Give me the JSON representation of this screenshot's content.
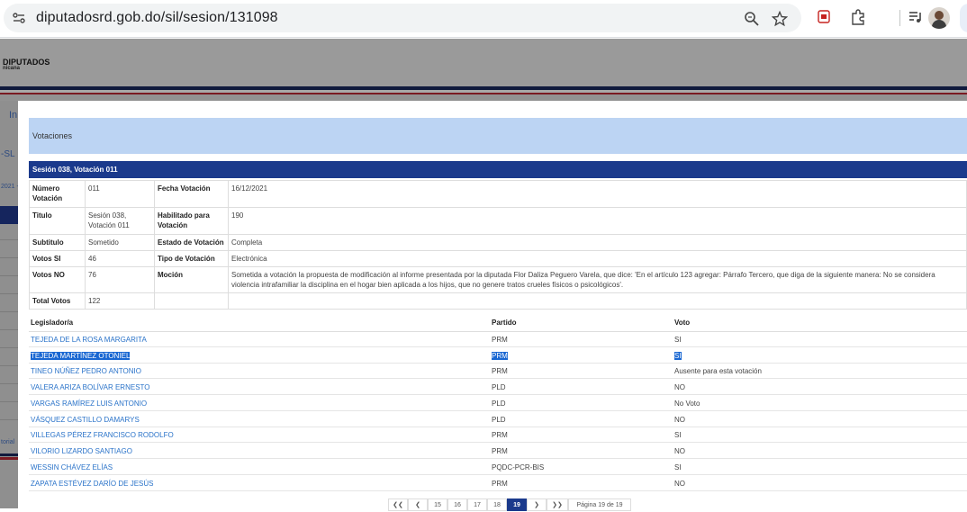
{
  "browser": {
    "url": "diputadosrd.gob.do/sil/sesion/131098"
  },
  "site": {
    "title": "DIPUTADOS",
    "subtitle": "nicana",
    "left_fragments": [
      "In",
      "-SL",
      "2021 -",
      "torial"
    ]
  },
  "modal": {
    "title": "Votaciones",
    "section": "Sesión 038, Votación 011",
    "info": {
      "numero_label": "Número Votación",
      "numero": "011",
      "fecha_label": "Fecha Votación",
      "fecha": "16/12/2021",
      "titulo_label": "Titulo",
      "titulo": "Sesión 038, Votación 011",
      "habilitado_label": "Habilitado para Votación",
      "habilitado": "190",
      "subtitulo_label": "Subtitulo",
      "subtitulo": "Sometido",
      "estado_label": "Estado de Votación",
      "estado": "Completa",
      "votos_si_label": "Votos SI",
      "votos_si": "46",
      "tipo_label": "Tipo de Votación",
      "tipo": "Electrónica",
      "votos_no_label": "Votos NO",
      "votos_no": "76",
      "mocion_label": "Moción",
      "mocion": "Sometida a votación la propuesta de modificación al informe presentada por la diputada Flor Daliza Peguero Varela, que dice: 'En el artículo 123 agregar: Párrafo Tercero, que diga de la siguiente manera: No se considera violencia intrafamiliar la disciplina en el hogar bien aplicada a los hijos, que no genere tratos crueles físicos o psicológicos'.",
      "total_label": "Total Votos",
      "total": "122"
    },
    "columns": {
      "legislador": "Legislador/a",
      "partido": "Partido",
      "voto": "Voto"
    },
    "rows": [
      {
        "name": "TEJEDA DE LA ROSA MARGARITA",
        "party": "PRM",
        "vote": "SI"
      },
      {
        "name": "TEJEDA MARTÍNEZ OTONIEL",
        "party": "PRM",
        "vote": "SI"
      },
      {
        "name": "TINEO NÚÑEZ PEDRO ANTONIO",
        "party": "PRM",
        "vote": "Ausente para esta votación"
      },
      {
        "name": "VALERA ARIZA BOLÍVAR ERNESTO",
        "party": "PLD",
        "vote": "NO"
      },
      {
        "name": "VARGAS RAMÍREZ LUIS ANTONIO",
        "party": "PLD",
        "vote": "No Voto"
      },
      {
        "name": "VÁSQUEZ CASTILLO DAMARYS",
        "party": "PLD",
        "vote": "NO"
      },
      {
        "name": "VILLEGAS PÉREZ FRANCISCO RODOLFO",
        "party": "PRM",
        "vote": "SI"
      },
      {
        "name": "VILORIO LIZARDO SANTIAGO",
        "party": "PRM",
        "vote": "NO"
      },
      {
        "name": "WESSIN CHÁVEZ ELÍAS",
        "party": "PQDC-PCR-BIS",
        "vote": "SI"
      },
      {
        "name": "ZAPATA ESTÉVEZ DARÍO DE JESÚS",
        "party": "PRM",
        "vote": "NO"
      }
    ],
    "pagination": {
      "first": "❮❮",
      "prev": "❮",
      "pages": [
        "15",
        "16",
        "17",
        "18",
        "19"
      ],
      "current": "19",
      "next": "❯",
      "last": "❯❯",
      "info": "Página 19 de 19"
    }
  },
  "colors": {
    "navy": "#1b3a8c",
    "header_light_blue": "#bcd4f3",
    "link_blue": "#2a73c9",
    "selection": "#1967d2"
  }
}
